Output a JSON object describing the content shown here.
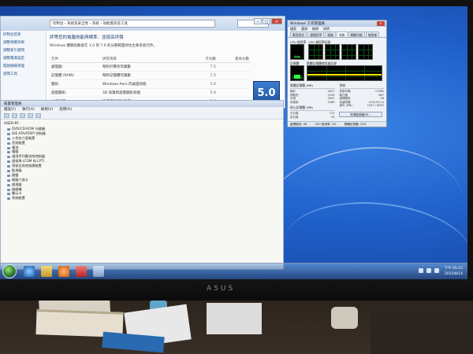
{
  "control_panel": {
    "address": "控制台 › 系統及安全性 › 系統 › 效能資訊及工具",
    "heading": "評等您的電腦效能與標準：並提高評價",
    "description": "Windows 體驗指數會在 1.0 到 7.9 的分數範圍評估主要系統元件。",
    "sidebar_items": [
      "控制台首頁",
      "調整視覺效果",
      "調整索引選項",
      "調整電源設定",
      "開啟磁碟清理",
      "進階工具"
    ],
    "table_headers": [
      "元件",
      "評等項目",
      "子分數",
      "基本分數"
    ],
    "rows": [
      {
        "component": "處理器:",
        "detail": "每秒計算的作業數",
        "score": "7.5"
      },
      {
        "component": "記憶體 (RAM):",
        "detail": "每秒記憶體作業數",
        "score": "7.5"
      },
      {
        "component": "圖形:",
        "detail": "Windows Aero 的桌面效能",
        "score": "5.0"
      },
      {
        "component": "遊戲圖形:",
        "detail": "3D 商業和遊戲圖形效能",
        "score": "5.9"
      },
      {
        "component": "主要硬碟:",
        "detail": "磁碟資料傳輸速率",
        "score": "5.9"
      }
    ],
    "base_score": "5.0",
    "base_score_label": "由最低子分數決定"
  },
  "device_manager": {
    "title": "裝置管理員",
    "menu": [
      "檔案(F)",
      "執行(A)",
      "檢視(V)",
      "說明(H)"
    ],
    "root": "USER-PC",
    "nodes": [
      "DVD/CD-ROM 光碟機",
      "IDE ATA/ATAPI 控制器",
      "人性化介面裝置",
      "音效裝置",
      "電池",
      "電腦",
      "通用序列匯流排控制器",
      "連接埠 (COM 和 LPT)",
      "滑鼠及其他指標裝置",
      "監視器",
      "鍵盤",
      "網路介面卡",
      "處理器",
      "磁碟機",
      "顯示卡",
      "系統裝置"
    ]
  },
  "task_manager": {
    "title": "Windows 工作管理員",
    "menu": [
      "檔案",
      "選項",
      "檢視",
      "說明"
    ],
    "tabs": [
      "應用程式",
      "處理程序",
      "服務",
      "效能",
      "網路功能",
      "使用者"
    ],
    "active_tab": "效能",
    "cpu_label": "CPU 使用率",
    "cpu_history_label": "CPU 使用率記錄",
    "cpu_usage": "3 %",
    "cpu_usage_fraction": 0.03,
    "mem_label": "記憶體",
    "mem_history_label": "實體記憶體使用量記錄",
    "mem_usage": "1.34 GB",
    "mem_usage_fraction": 0.35,
    "physical_memory": {
      "title": "實體記憶體 (MB)",
      "lines": [
        [
          "總計",
          "4027"
        ],
        [
          "快取的",
          "1226"
        ],
        [
          "可用",
          "2647"
        ],
        [
          "未使用",
          "1465"
        ]
      ]
    },
    "system": {
      "title": "系統",
      "lines": [
        [
          "控制代碼",
          "17985"
        ],
        [
          "執行緒",
          "667"
        ],
        [
          "處理程序",
          "56"
        ],
        [
          "存留時間",
          "0:00:03:14"
        ],
        [
          "認可 (MB)",
          "1527 / 8052"
        ]
      ]
    },
    "kernel_memory": {
      "title": "核心記憶體 (MB)",
      "lines": [
        [
          "已分頁",
          "172"
        ],
        [
          "未分頁",
          "59"
        ]
      ]
    },
    "resource_button": "資源監視器(R)...",
    "status": {
      "processes": "處理程序: 56",
      "cpu": "CPU 使用率: 3%",
      "memory": "實體記憶體: 33%"
    }
  },
  "taskbar": {
    "time": "下午 05:15",
    "date": "2015/8/14"
  },
  "monitor_brand": "ASUS",
  "colors": {
    "desktop": "#1f5fc9",
    "graph_green": "#2cff4a",
    "memory_yellow": "#ffe600"
  }
}
